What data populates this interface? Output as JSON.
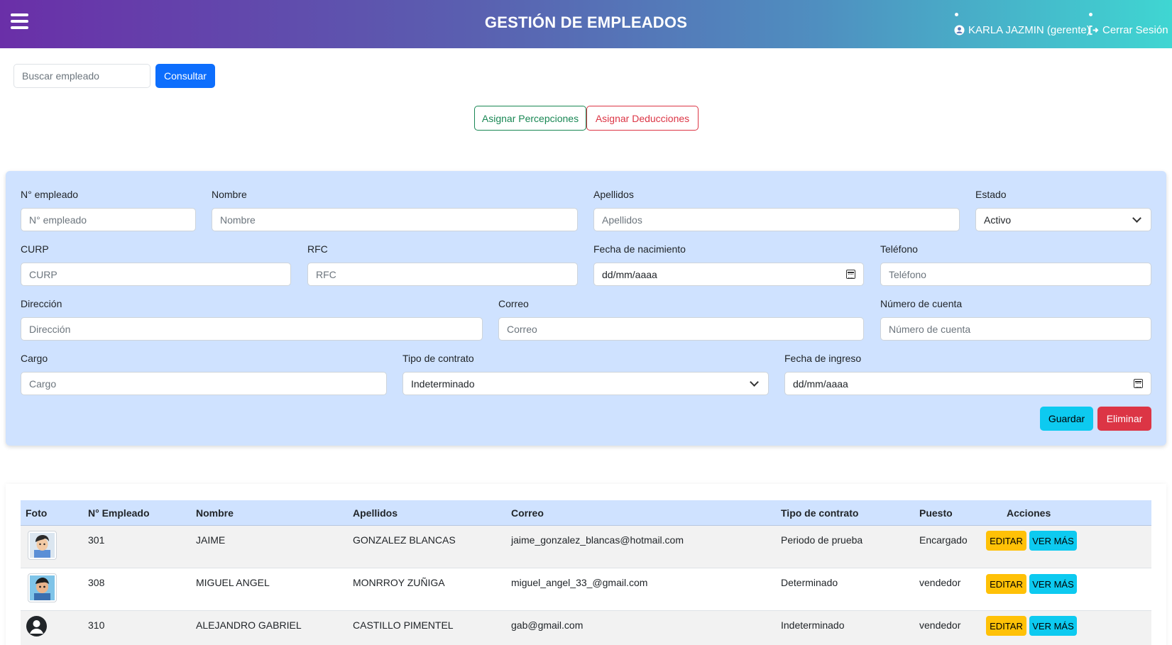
{
  "header": {
    "title": "GESTIÓN DE EMPLEADOS",
    "user_label": "KARLA JAZMIN (gerente)",
    "logout_label": "Cerrar Sesión"
  },
  "search": {
    "placeholder": "Buscar empleado",
    "button_label": "Consultar"
  },
  "actions": {
    "perc_label": "Asignar Percepciones",
    "ded_label": "Asignar Deducciones"
  },
  "form": {
    "num_label": "N° empleado",
    "num_placeholder": "N° empleado",
    "nombre_label": "Nombre",
    "nombre_placeholder": "Nombre",
    "apellidos_label": "Apellidos",
    "apellidos_placeholder": "Apellidos",
    "estado_label": "Estado",
    "estado_value": "Activo",
    "curp_label": "CURP",
    "curp_placeholder": "CURP",
    "rfc_label": "RFC",
    "rfc_placeholder": "RFC",
    "fnac_label": "Fecha de nacimiento",
    "fnac_value": "dd/mm/aaaa",
    "tel_label": "Teléfono",
    "tel_placeholder": "Teléfono",
    "dir_label": "Dirección",
    "dir_placeholder": "Dirección",
    "correo_label": "Correo",
    "correo_placeholder": "Correo",
    "cuenta_label": "Número de cuenta",
    "cuenta_placeholder": "Número de cuenta",
    "cargo_label": "Cargo",
    "cargo_placeholder": "Cargo",
    "contrato_label": "Tipo de contrato",
    "contrato_value": "Indeterminado",
    "fing_label": "Fecha de ingreso",
    "fing_value": "dd/mm/aaaa",
    "save_label": "Guardar",
    "delete_label": "Eliminar"
  },
  "table": {
    "columns": [
      "Foto",
      "N° Empleado",
      "Nombre",
      "Apellidos",
      "Correo",
      "Tipo de contrato",
      "Puesto",
      "Acciones"
    ],
    "edit_label": "EDITAR",
    "more_label": "VER MÁS",
    "rows": [
      {
        "num": "301",
        "nombre": "JAIME",
        "apellidos": "GONZALEZ BLANCAS",
        "correo": "jaime_gonzalez_blancas@hotmail.com",
        "contrato": "Periodo de prueba",
        "puesto": "Encargado"
      },
      {
        "num": "308",
        "nombre": "MIGUEL ANGEL",
        "apellidos": "MONRROY ZUÑIGA",
        "correo": "miguel_angel_33_@gmail.com",
        "contrato": "Determinado",
        "puesto": "vendedor"
      },
      {
        "num": "310",
        "nombre": "ALEJANDRO GABRIEL",
        "apellidos": "CASTILLO PIMENTEL",
        "correo": "gab@gmail.com",
        "contrato": "Indeterminado",
        "puesto": "vendedor"
      }
    ]
  },
  "colors": {
    "primary": "#0d6efd",
    "success": "#198754",
    "danger": "#dc3545",
    "info": "#0dcaf0",
    "warning": "#ffc107",
    "form_bg": "#cfe2ff"
  },
  "icons": [
    "menu-icon",
    "user-circle-icon",
    "logout-icon",
    "chevron-down-icon",
    "calendar-icon",
    "avatar-icon"
  ]
}
